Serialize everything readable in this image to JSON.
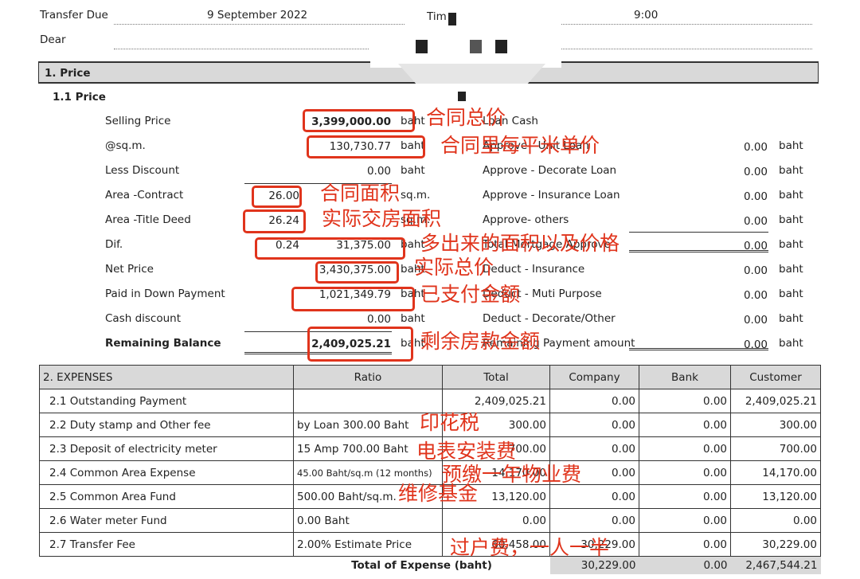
{
  "header": {
    "transfer_due_label": "Transfer Due",
    "transfer_due_value": "9 September 2022",
    "time_label": "Tim",
    "time_value": "9:00",
    "dear_label": "Dear"
  },
  "section1": {
    "title": "1. Price",
    "subtitle": "1.1 Price"
  },
  "price_left": [
    {
      "label": "Selling Price",
      "value": "3,399,000.00",
      "unit": "baht"
    },
    {
      "label": "@sq.m.",
      "value": "130,730.77",
      "unit": "baht"
    },
    {
      "label": "Less Discount",
      "value": "0.00",
      "unit": "baht"
    },
    {
      "label": "Area -Contract",
      "small": "26.00",
      "unit": "sq.m."
    },
    {
      "label": "Area -Title Deed",
      "small": "26.24",
      "unit": "sq.m."
    },
    {
      "label": "Dif.",
      "small": "0.24",
      "value": "31,375.00",
      "unit": "baht"
    },
    {
      "label": "Net Price",
      "value": "3,430,375.00",
      "unit": "baht"
    },
    {
      "label": "Paid in Down Payment",
      "value": "1,021,349.79",
      "unit": "baht"
    },
    {
      "label": "Cash discount",
      "value": "0.00",
      "unit": "baht"
    },
    {
      "label": "Remaining Balance",
      "value": "2,409,025.21",
      "unit": "baht"
    }
  ],
  "price_right": [
    {
      "label": "Loan Cash",
      "value": "",
      "unit": ""
    },
    {
      "label": "Approve - Unit Loan",
      "value": "0.00",
      "unit": "baht"
    },
    {
      "label": "Approve - Decorate Loan",
      "value": "0.00",
      "unit": "baht"
    },
    {
      "label": "Approve - Insurance Loan",
      "value": "0.00",
      "unit": "baht"
    },
    {
      "label": "Approve- others",
      "value": "0.00",
      "unit": "baht"
    },
    {
      "label": "Total Mortgage Approve",
      "value": "0.00",
      "unit": "baht"
    },
    {
      "label": "Deduct - Insurance",
      "value": "0.00",
      "unit": "baht"
    },
    {
      "label": "Deduct - Muti Purpose",
      "value": "0.00",
      "unit": "baht"
    },
    {
      "label": "Deduct - Decorate/Other",
      "value": "0.00",
      "unit": "baht"
    },
    {
      "label": "Remaining Payment amount",
      "value": "0.00",
      "unit": "baht"
    }
  ],
  "expenses": {
    "headers": [
      "2. EXPENSES",
      "Ratio",
      "Total",
      "Company",
      "Bank",
      "Customer"
    ],
    "rows": [
      [
        "2.1 Outstanding Payment",
        "",
        "2,409,025.21",
        "0.00",
        "0.00",
        "2,409,025.21"
      ],
      [
        "2.2 Duty stamp and Other fee",
        "by Loan 300.00 Baht",
        "300.00",
        "0.00",
        "0.00",
        "300.00"
      ],
      [
        "2.3 Deposit of electricity meter",
        "15 Amp 700.00 Baht",
        "700.00",
        "0.00",
        "0.00",
        "700.00"
      ],
      [
        "2.4 Common Area Expense",
        "45.00 Baht/sq.m (12 months)",
        "14,170.00",
        "0.00",
        "0.00",
        "14,170.00"
      ],
      [
        "2.5 Common Area Fund",
        "500.00 Baht/sq.m.",
        "13,120.00",
        "0.00",
        "0.00",
        "13,120.00"
      ],
      [
        "2.6 Water meter Fund",
        "0.00 Baht",
        "0.00",
        "0.00",
        "0.00",
        "0.00"
      ],
      [
        "2.7 Transfer Fee",
        "2.00% Estimate Price",
        "60,458.00",
        "30,229.00",
        "0.00",
        "30,229.00"
      ]
    ],
    "total": {
      "label": "Total of Expense (baht)",
      "company": "30,229.00",
      "bank": "0.00",
      "customer": "2,467,544.21"
    }
  },
  "annotations": {
    "color": "#e0341c",
    "items": [
      "合同总价",
      "合同里每平米单价",
      "合同面积",
      "实际交房面积",
      "多出来的面积以及价格",
      "实际总价",
      "已支付金额",
      "剩余房款金额",
      "印花税",
      "电表安装费",
      "预缴一年物业费",
      "维修基金",
      "过户费，一人一半"
    ]
  }
}
